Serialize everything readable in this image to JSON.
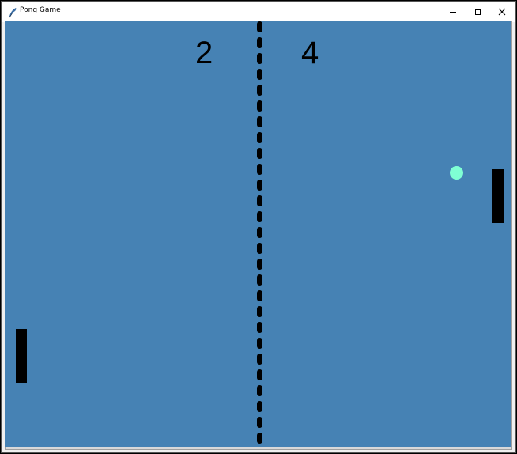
{
  "window": {
    "title": "Pong Game"
  },
  "scores": {
    "left": "2",
    "right": "4"
  },
  "colors": {
    "court": "#4682b4",
    "ball": "#7fffd4",
    "paddle": "#000000",
    "net": "#000000"
  },
  "icons": {
    "app": "feather-icon",
    "minimize": "minimize-icon",
    "maximize": "maximize-icon",
    "close": "close-icon"
  }
}
